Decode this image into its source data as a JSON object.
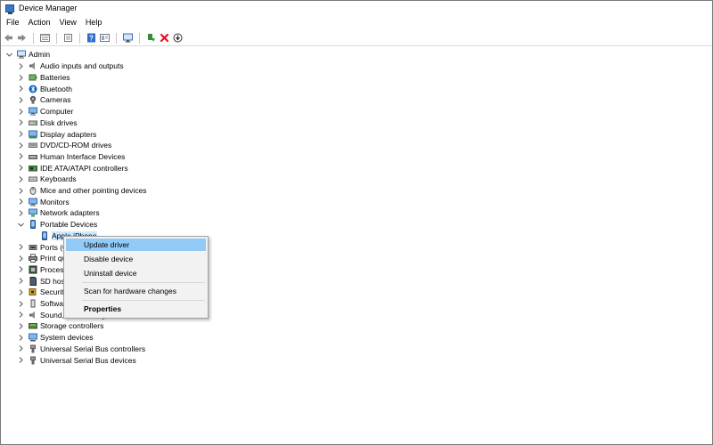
{
  "window": {
    "title": "Device Manager"
  },
  "menubar": [
    "File",
    "Action",
    "View",
    "Help"
  ],
  "toolbar": {
    "buttons": [
      "back-icon",
      "forward-icon",
      "properties-icon",
      "show-hidden-icon",
      "help-icon",
      "view-icon",
      "monitor-icon",
      "update-driver-icon",
      "uninstall-icon",
      "download-icon"
    ]
  },
  "tree": {
    "root": "Admin",
    "categories": [
      "Audio inputs and outputs",
      "Batteries",
      "Bluetooth",
      "Cameras",
      "Computer",
      "Disk drives",
      "Display adapters",
      "DVD/CD-ROM drives",
      "Human Interface Devices",
      "IDE ATA/ATAPI controllers",
      "Keyboards",
      "Mice and other pointing devices",
      "Monitors",
      "Network adapters",
      "Portable Devices",
      "Ports (COM & LPT)",
      "Print queues",
      "Processors",
      "SD host adapters",
      "Security devices",
      "Software devices",
      "Sound, video and game controllers",
      "Storage controllers",
      "System devices",
      "Universal Serial Bus controllers",
      "Universal Serial Bus devices"
    ],
    "expanded_child": "Apple iPhone"
  },
  "context_menu": {
    "items": [
      "Update driver",
      "Disable device",
      "Uninstall device",
      "Scan for hardware changes",
      "Properties"
    ]
  },
  "colors": {
    "highlight": "#91c9f7",
    "selection": "#cce8ff",
    "error_red": "#e81123"
  }
}
